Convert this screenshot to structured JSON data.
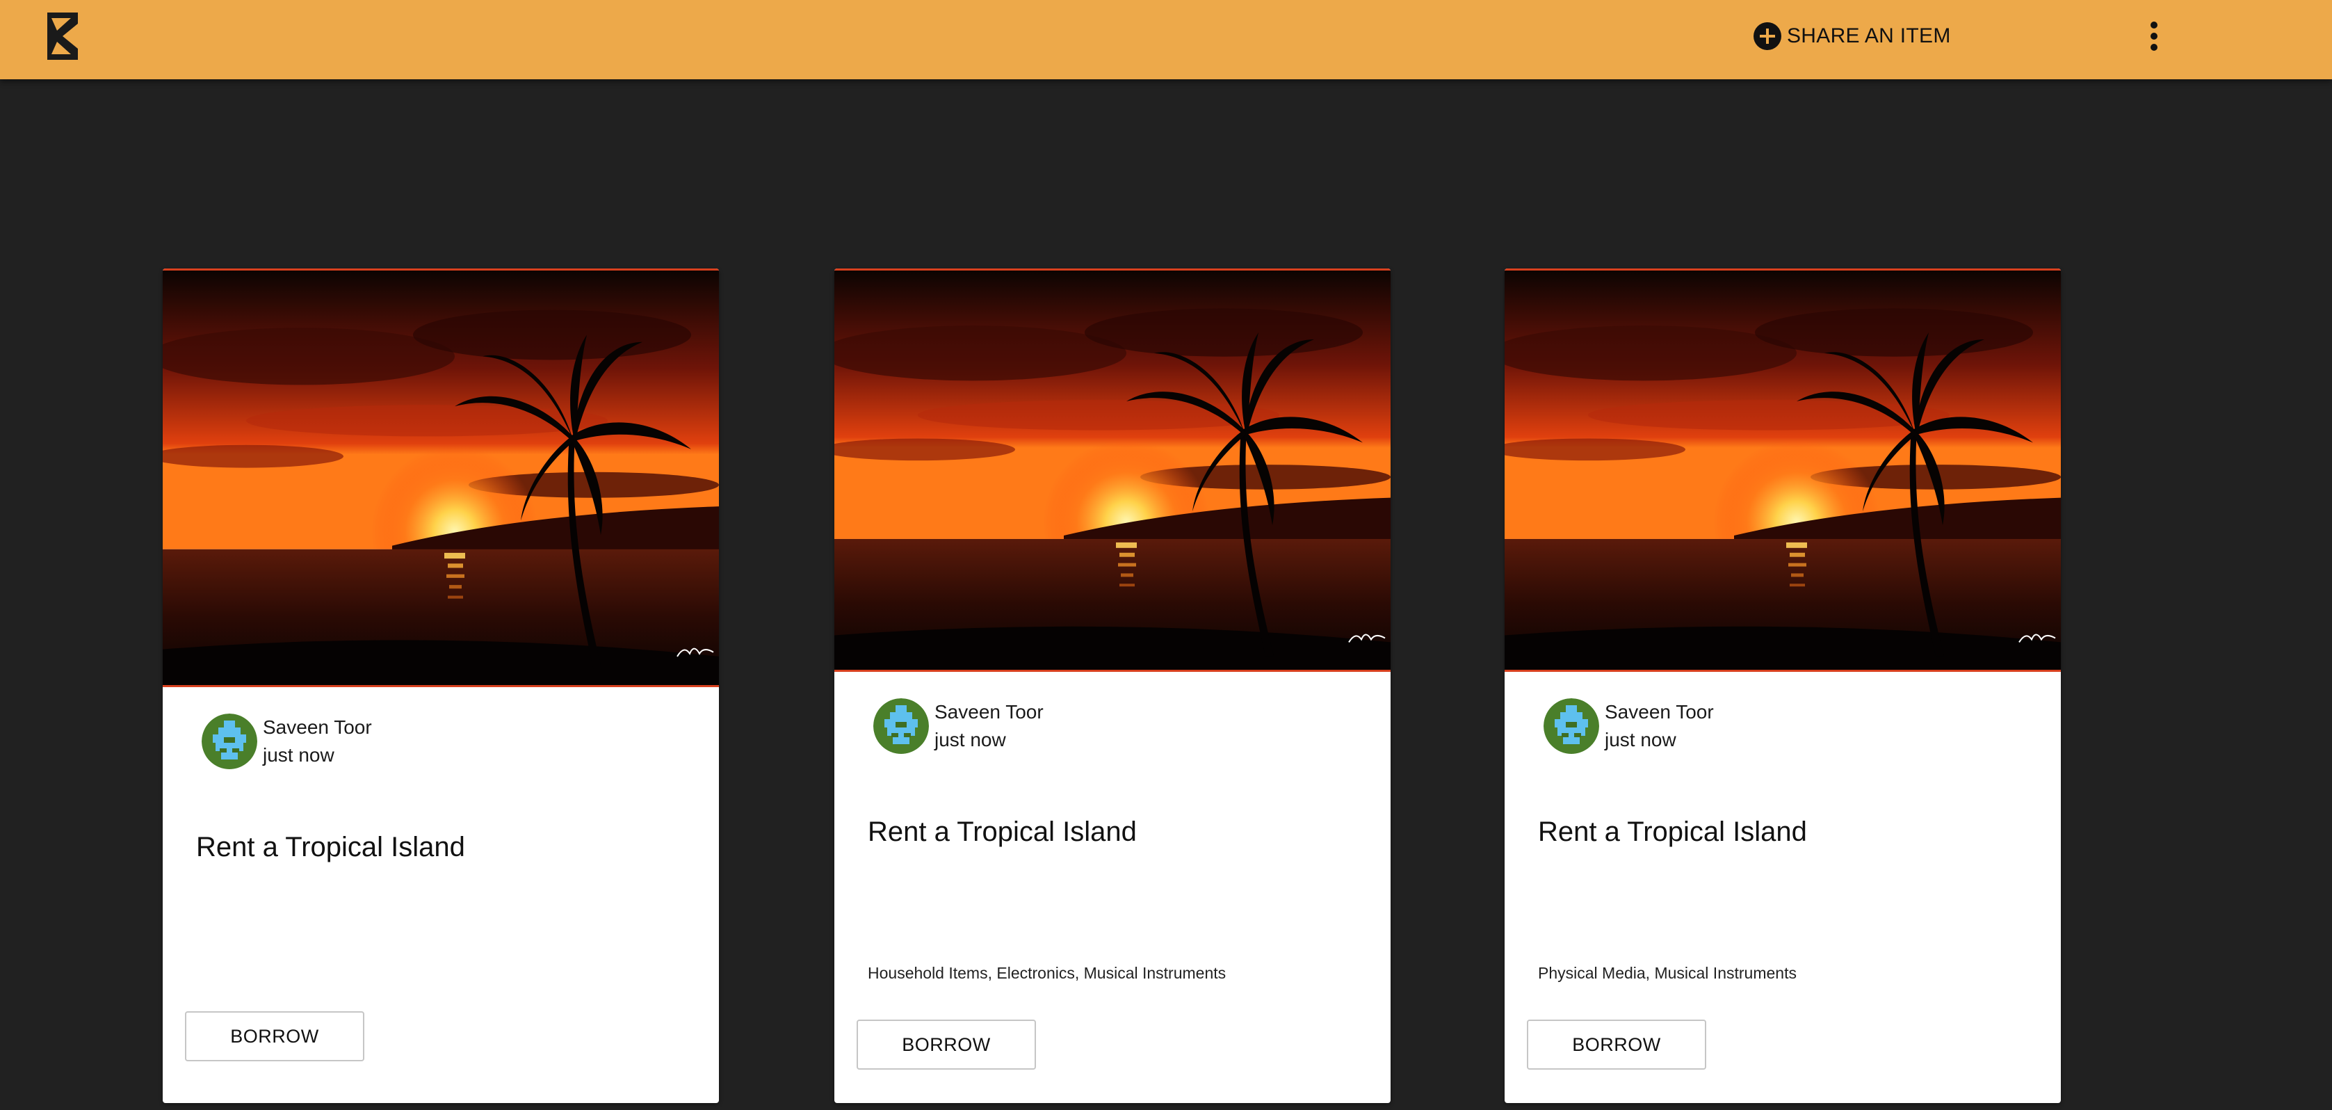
{
  "header": {
    "logo_icon": "boomtown-logo-icon",
    "share_label": "SHARE AN ITEM",
    "share_icon": "add-circle-icon",
    "more_icon": "more-vert-icon",
    "bar_color": "#EDA94A",
    "background_color": "#212121"
  },
  "items": [
    {
      "image": "tropical-sunset-palm-photo",
      "owner_name": "Saveen Toor",
      "time": "just now",
      "title": "Rent a Tropical Island",
      "tags": "",
      "button_label": "BORROW"
    },
    {
      "image": "tropical-sunset-palm-photo",
      "owner_name": "Saveen Toor",
      "time": "just now",
      "title": "Rent a Tropical Island",
      "tags": "Household Items, Electronics, Musical Instruments",
      "button_label": "BORROW"
    },
    {
      "image": "tropical-sunset-palm-photo",
      "owner_name": "Saveen Toor",
      "time": "just now",
      "title": "Rent a Tropical Island",
      "tags": "Physical Media, Musical Instruments",
      "button_label": "BORROW"
    }
  ]
}
